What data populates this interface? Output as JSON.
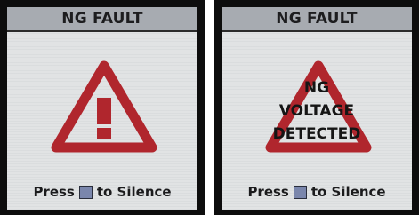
{
  "panels": [
    {
      "title": "NG FAULT",
      "icon": "warning-exclamation-icon",
      "message_lines": [],
      "footer": {
        "before": "Press",
        "after": "to Silence",
        "key_icon": "silence-key-icon"
      }
    },
    {
      "title": "NG FAULT",
      "icon": "warning-triangle-icon",
      "message_lines": [
        "NG",
        "VOLTAGE",
        "DETECTED"
      ],
      "footer": {
        "before": "Press",
        "after": "to Silence",
        "key_icon": "silence-key-icon"
      }
    }
  ],
  "colors": {
    "bezel": "#0d0d0d",
    "lcd_background": "#e1e3e4",
    "title_bar": "#a7abb1",
    "warning_red": "#b0262d",
    "silence_key": "#7a86ac",
    "text": "#1b1b1d"
  }
}
